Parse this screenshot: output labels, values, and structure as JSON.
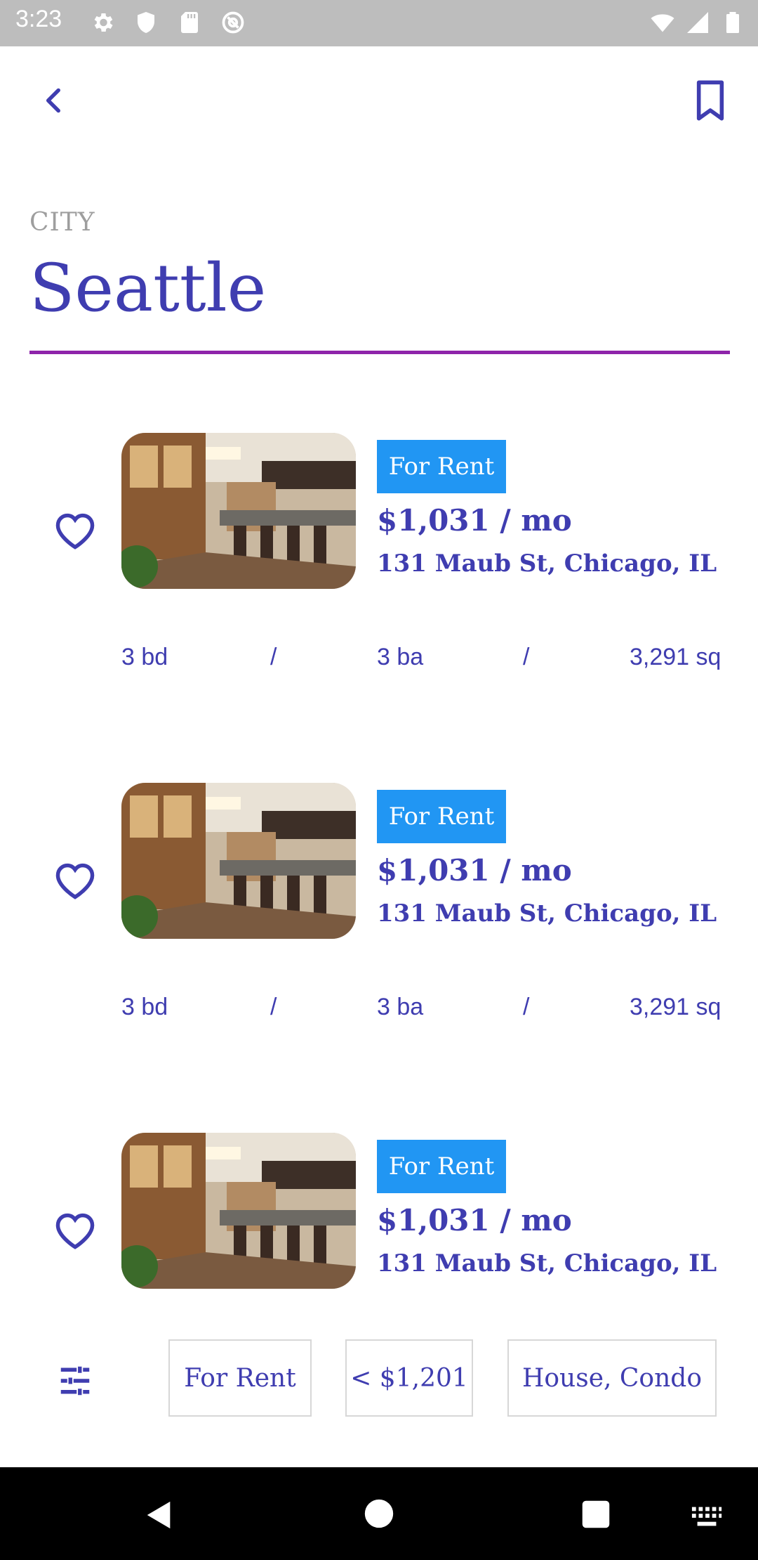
{
  "status_bar": {
    "time": "3:23",
    "left_icons": [
      "gear-icon",
      "shield-icon",
      "sd-card-icon",
      "at-sign-icon"
    ],
    "right_icons": [
      "wifi-icon",
      "cell-signal-icon",
      "battery-icon"
    ]
  },
  "header": {
    "back_icon": "chevron-left-icon",
    "bookmark_icon": "bookmark-icon"
  },
  "city": {
    "label": "CITY",
    "value": "Seattle"
  },
  "listings": [
    {
      "badge": "For Rent",
      "price": "$1,031 / mo",
      "address": "131 Maub St, Chicago, IL",
      "beds": "3 bd",
      "sep1": "/",
      "baths": "3 ba",
      "sep2": "/",
      "sqft": "3,291 sq"
    },
    {
      "badge": "For Rent",
      "price": "$1,031 / mo",
      "address": "131 Maub St, Chicago, IL",
      "beds": "3 bd",
      "sep1": "/",
      "baths": "3 ba",
      "sep2": "/",
      "sqft": "3,291 sq"
    },
    {
      "badge": "For Rent",
      "price": "$1,031 / mo",
      "address": "131 Maub St, Chicago, IL"
    }
  ],
  "filters": {
    "icon": "tune-icon",
    "chips": [
      "For Rent",
      "< $1,201",
      "House, Condo"
    ]
  },
  "colors": {
    "primary": "#3f3db0",
    "badge": "#2196f3",
    "underline": "#8e24aa",
    "label_gray": "#9e9e9e"
  }
}
